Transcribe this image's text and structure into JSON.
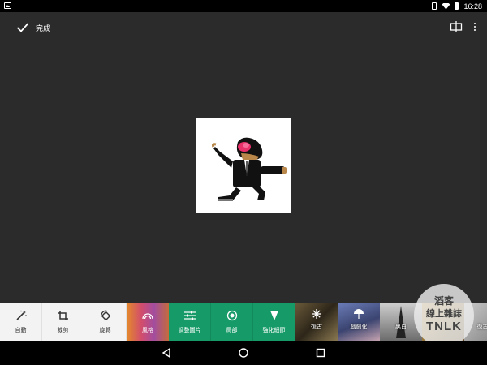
{
  "status_bar": {
    "time": "16:28",
    "icons": [
      "image-notification-icon",
      "vibrate-icon",
      "wifi-icon",
      "battery-icon"
    ]
  },
  "app_bar": {
    "done_label": "完成",
    "icons": [
      "check-icon",
      "compare-icon",
      "more-vert-icon"
    ]
  },
  "toolbar": {
    "tools": [
      {
        "label": "自動",
        "icon": "auto-magic-wand-icon"
      },
      {
        "label": "裁剪",
        "icon": "crop-icon"
      },
      {
        "label": "旋轉",
        "icon": "rotate-icon"
      },
      {
        "label": "風格",
        "icon": "rainbow-icon"
      },
      {
        "label": "調整圖片",
        "icon": "sliders-icon"
      },
      {
        "label": "局部",
        "icon": "target-icon"
      },
      {
        "label": "強化細節",
        "icon": "triangle-down-icon"
      }
    ],
    "filters": [
      {
        "label": "復古",
        "icon": "sparkle-icon"
      },
      {
        "label": "戲劇化",
        "icon": "umbrella-icon"
      },
      {
        "label": "黑白",
        "icon": ""
      },
      {
        "label": "",
        "icon": ""
      },
      {
        "label": "復古海",
        "icon": ""
      }
    ]
  },
  "watermark": {
    "line1": "滔客",
    "line2": "線上雜誌",
    "mark": "TNLK"
  },
  "nav_bar": {
    "icons": [
      "back-icon",
      "home-icon",
      "recents-icon"
    ]
  },
  "colors": {
    "background": "#2b2b2b",
    "accent_green": "#169b68",
    "toolbar_light": "#f3f3f3"
  }
}
